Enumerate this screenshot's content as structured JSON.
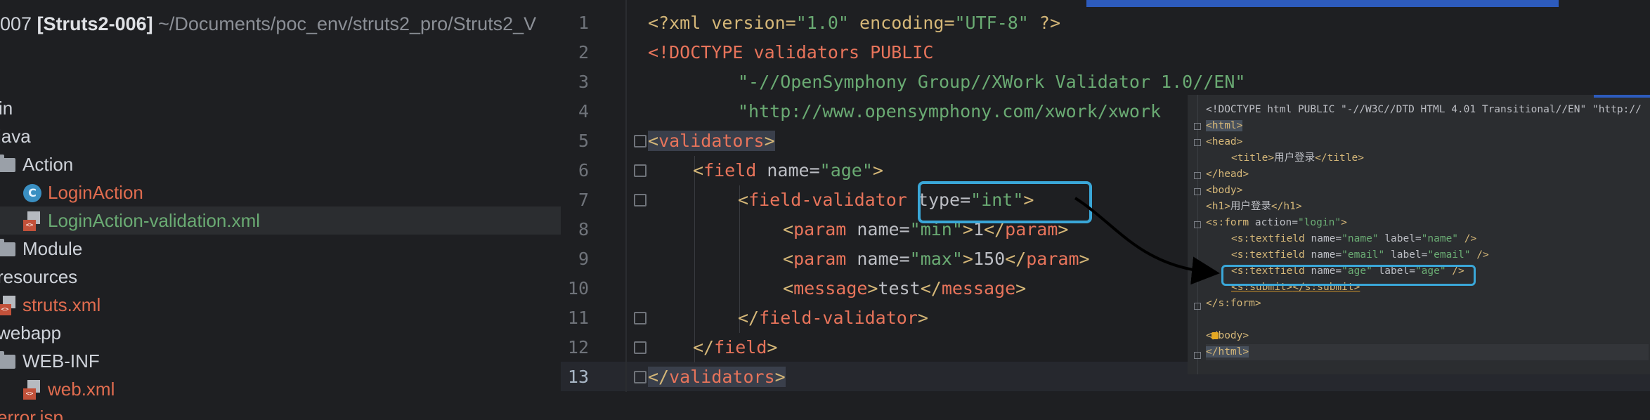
{
  "project": {
    "title_prefix": "007 ",
    "title_name": "[Struts2-006]",
    "title_path": " ~/Documents/poc_env/struts2_pro/Struts2_V",
    "tree": [
      {
        "label": "in",
        "kind": "text"
      },
      {
        "label": "java",
        "kind": "text"
      },
      {
        "label": "Action",
        "kind": "folder"
      },
      {
        "label": "LoginAction",
        "kind": "class"
      },
      {
        "label": "LoginAction-validation.xml",
        "kind": "xml"
      },
      {
        "label": "Module",
        "kind": "folder"
      },
      {
        "label": "resources",
        "kind": "text"
      },
      {
        "label": "struts.xml",
        "kind": "xml"
      },
      {
        "label": "webapp",
        "kind": "text"
      },
      {
        "label": "WEB-INF",
        "kind": "folder"
      },
      {
        "label": "web.xml",
        "kind": "xml"
      },
      {
        "label": "error.jsp",
        "kind": "text"
      }
    ],
    "class_icon_letter": "C",
    "xml_icon_text": "<>"
  },
  "editor": {
    "line_numbers": [
      "1",
      "2",
      "3",
      "4",
      "5",
      "6",
      "7",
      "8",
      "9",
      "10",
      "11",
      "12",
      "13"
    ],
    "l1": {
      "a": "<?xml version=",
      "b": "\"1.0\"",
      "c": " encoding=",
      "d": "\"UTF-8\"",
      "e": " ?>"
    },
    "l2": {
      "a": "<!DOCTYPE validators PUBLIC"
    },
    "l3": {
      "a": "\"-//OpenSymphony Group//XWork Validator 1.0//EN\""
    },
    "l4": {
      "a": "\"http://www.opensymphony.com/xwork/xwork"
    },
    "l5": {
      "a": "<",
      "b": "validators",
      "c": ">"
    },
    "l6": {
      "a": "<",
      "b": "field",
      "c": " name=",
      "d": "\"age\"",
      "e": ">"
    },
    "l7": {
      "a": "<",
      "b": "field-validator",
      "c": " type=",
      "d": "\"int\"",
      "e": ">"
    },
    "l8": {
      "a": "<",
      "b": "param",
      "c": " name=",
      "d": "\"min\"",
      "e": ">",
      "f": "1",
      "g": "</",
      "h": "param",
      "i": ">"
    },
    "l9": {
      "a": "<",
      "b": "param",
      "c": " name=",
      "d": "\"max\"",
      "e": ">",
      "f": "150",
      "g": "</",
      "h": "param",
      "i": ">"
    },
    "l10": {
      "a": "<",
      "b": "message",
      "c": ">",
      "d": "test",
      "e": "</",
      "f": "message",
      "g": ">"
    },
    "l11": {
      "a": "</",
      "b": "field-validator",
      "c": ">"
    },
    "l12": {
      "a": "</",
      "b": "field",
      "c": ">"
    },
    "l13": {
      "a": "</",
      "b": "validators",
      "c": ">"
    }
  },
  "overlay": {
    "o1": "<!DOCTYPE html PUBLIC \"-//W3C//DTD HTML 4.01 Transitional//EN\" \"http://",
    "o2": "<html>",
    "o3": "<head>",
    "o4a": "<title>",
    "o4b": "用户登录",
    "o4c": "</title>",
    "o5": "</head>",
    "o6": "<body>",
    "o7a": "<h1>",
    "o7b": "用户登录",
    "o7c": "</h1>",
    "o8a": "<s:form",
    "o8b": " action=",
    "o8c": "\"login\"",
    "o8d": ">",
    "o9a": "<s:textfield",
    "o9b": " name=",
    "o9c": "\"name\"",
    "o9d": " label=",
    "o9e": "\"name\"",
    "o9f": " />",
    "o10a": "<s:textfield",
    "o10b": " name=",
    "o10c": "\"email\"",
    "o10d": " label=",
    "o10e": "\"email\"",
    "o10f": " />",
    "o11a": "<s:textfield",
    "o11b": " name=",
    "o11c": "\"age\"",
    "o11d": " label=",
    "o11e": "\"age\"",
    "o11f": " />",
    "o12a": "<s:submit>",
    "o12b": "</s:submit>",
    "o13": "</s:form>",
    "o14": "</body>",
    "o15": "</html>"
  },
  "colors": {
    "accent": "#3aa7d8",
    "tag": "#d5b778",
    "string": "#6aab73",
    "error_red": "#e06c4f"
  }
}
